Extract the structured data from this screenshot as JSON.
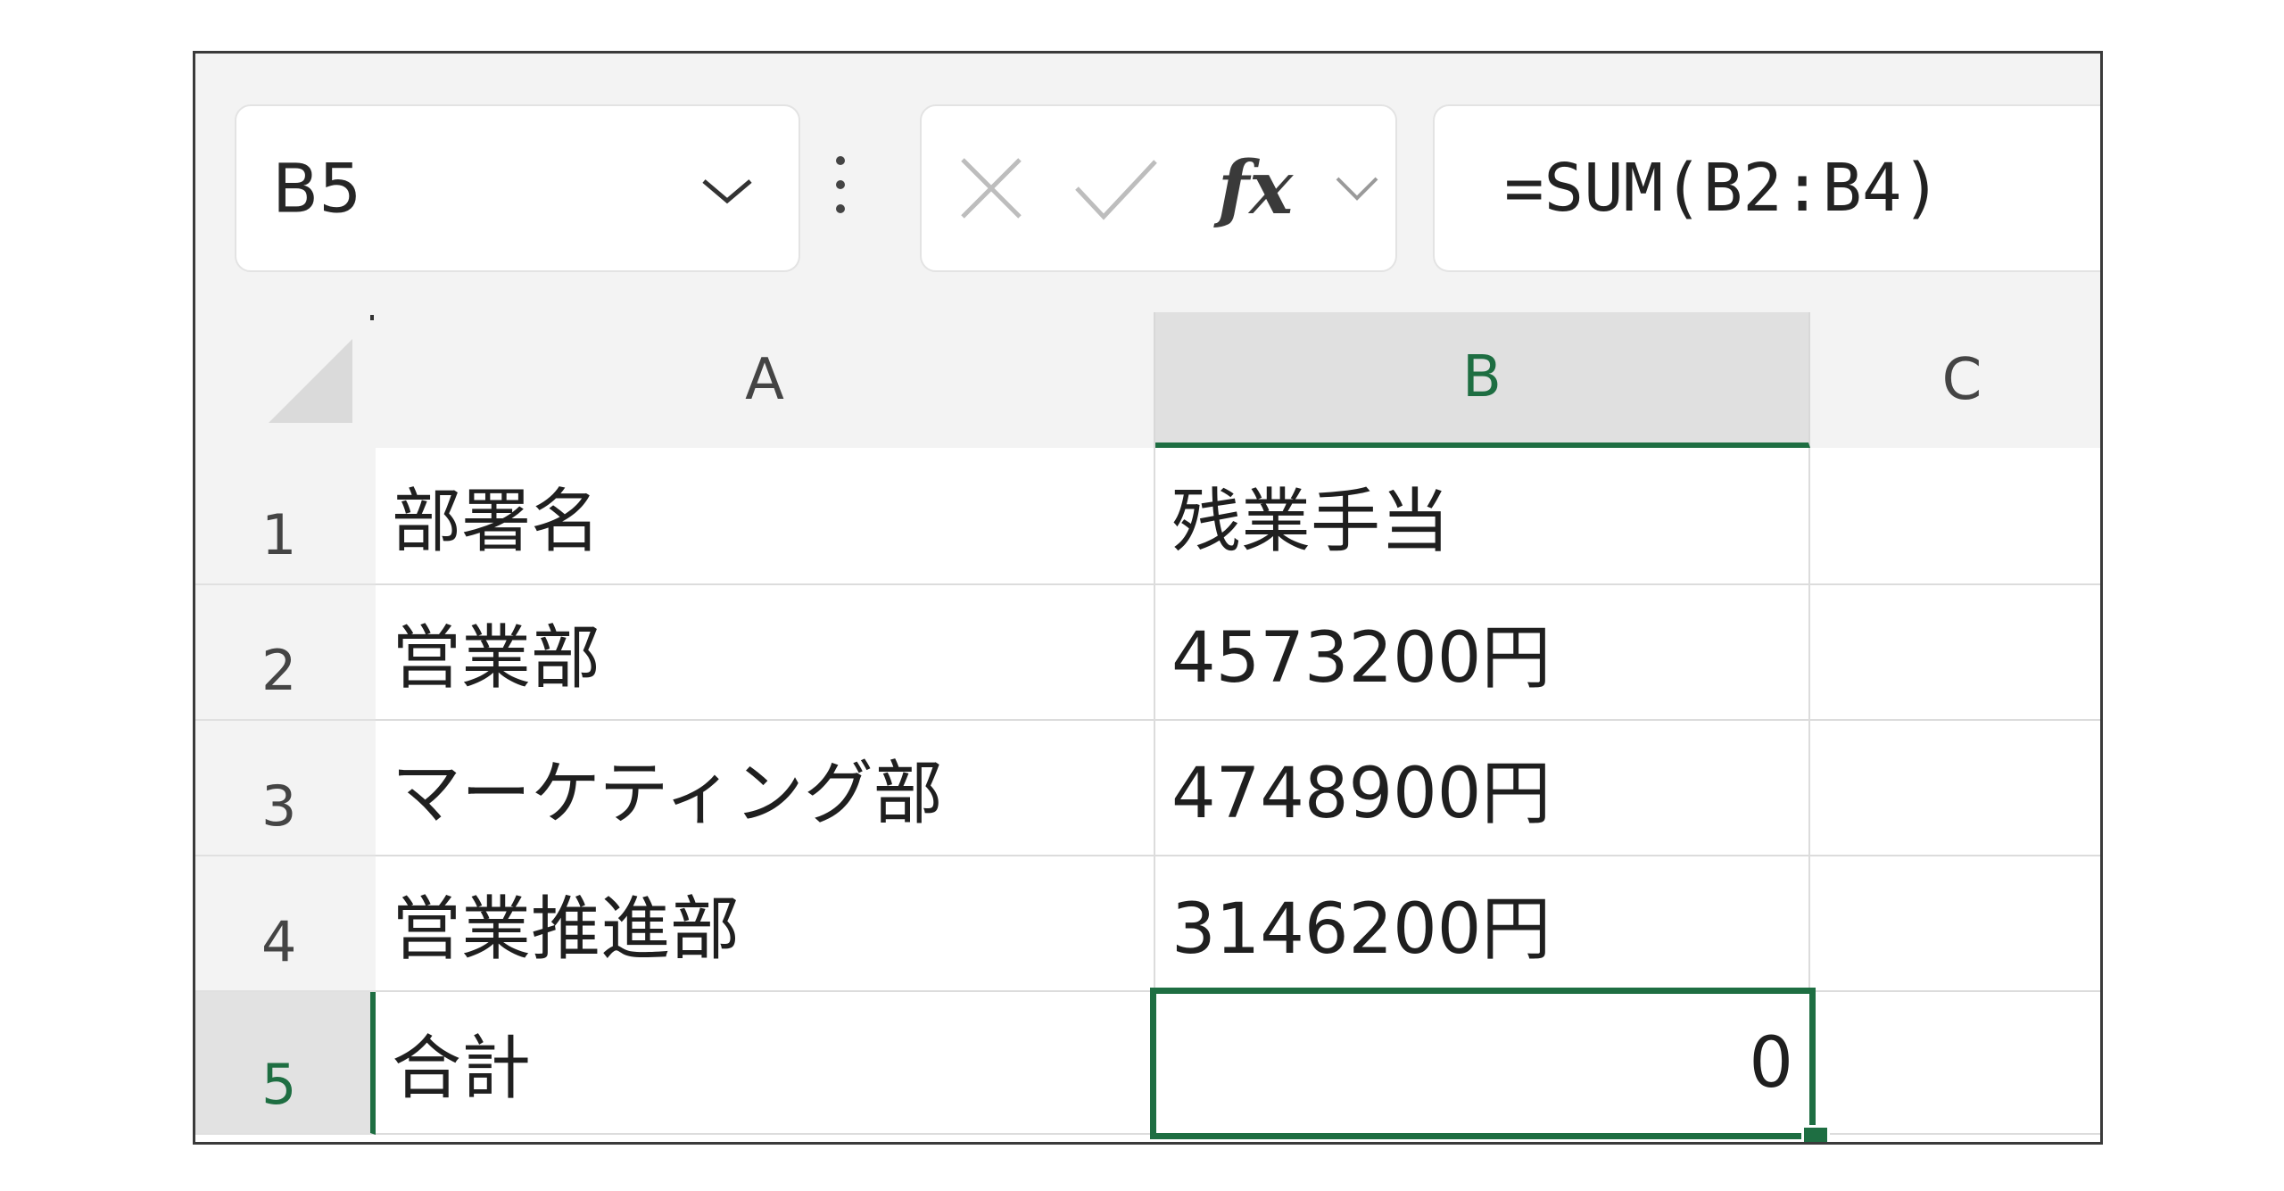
{
  "name_box": {
    "value": "B5"
  },
  "formula_bar": {
    "cancel_icon": "x-icon",
    "enter_icon": "check-icon",
    "fx_label": "fx",
    "formula": "=SUM(B2:B4)"
  },
  "columns": [
    "A",
    "B",
    "C"
  ],
  "rows": [
    {
      "num": "1",
      "a": "部署名",
      "b": "残業手当",
      "c": ""
    },
    {
      "num": "2",
      "a": "営業部",
      "b": "4573200円",
      "c": ""
    },
    {
      "num": "3",
      "a": "マーケティング部",
      "b": "4748900円",
      "c": ""
    },
    {
      "num": "4",
      "a": "営業推進部",
      "b": "3146200円",
      "c": ""
    },
    {
      "num": "5",
      "a": "合計",
      "b": "0",
      "c": ""
    }
  ],
  "selection": {
    "active_cell": "B5"
  },
  "colors": {
    "accent": "#1e6e42",
    "header_bg": "#f3f3f3"
  }
}
